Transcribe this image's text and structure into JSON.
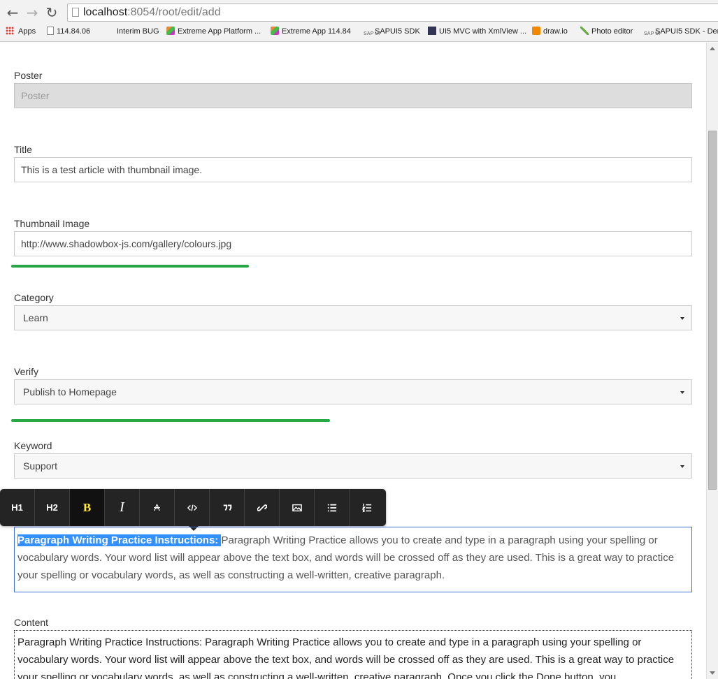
{
  "browser": {
    "url_host": "localhost",
    "url_path": ":8054/root/edit/add",
    "bookmarks": [
      {
        "label": "Apps",
        "icon": "apps-grid-icon"
      },
      {
        "label": "114.84.06",
        "icon": "page-icon"
      },
      {
        "label": "Interim BUG",
        "icon": ""
      },
      {
        "label": "Extreme App Platform ...",
        "icon": "puzzle-icon"
      },
      {
        "label": "Extreme App 114.84",
        "icon": "puzzle-icon"
      },
      {
        "label": "SAPUI5 SDK",
        "icon": "sap-icon"
      },
      {
        "label": "UI5 MVC with XmlView ...",
        "icon": "ui5-icon"
      },
      {
        "label": "draw.io",
        "icon": "drawio-icon"
      },
      {
        "label": "Photo editor",
        "icon": "photo-icon"
      },
      {
        "label": "SAPUI5 SDK - Dem",
        "icon": "sap-icon"
      }
    ]
  },
  "form": {
    "poster": {
      "label": "Poster",
      "placeholder": "Poster"
    },
    "title": {
      "label": "Title",
      "value": "This is a test article with thumbnail image."
    },
    "thumbnail": {
      "label": "Thumbnail Image",
      "value": "http://www.shadowbox-js.com/gallery/colours.jpg",
      "progress": 0.35
    },
    "category": {
      "label": "Category",
      "value": "Learn"
    },
    "verify": {
      "label": "Verify",
      "value": "Publish to Homepage",
      "progress": 0.47
    },
    "keyword": {
      "label": "Keyword",
      "value": "Support"
    },
    "content": {
      "label": "Content"
    }
  },
  "toolbar": {
    "h1": "H1",
    "h2": "H2",
    "bold": "B",
    "italic": "I",
    "strike": "A",
    "buttons": [
      "code-icon",
      "quote-icon",
      "link-icon",
      "image-icon",
      "unordered-list-icon",
      "ordered-list-icon"
    ]
  },
  "editor": {
    "selected_text": "Paragraph Writing Practice Instructions: ",
    "rest_text": "Paragraph Writing Practice allows you to create and type in a paragraph using your spelling or vocabulary words. Your word list will appear above the text box, and words will be crossed off as they are used. This is a great way to practice your spelling or vocabulary words, as well as constructing a well-written, creative paragraph."
  },
  "content_text": "Paragraph Writing Practice Instructions: Paragraph Writing Practice allows you to create and type in a paragraph using your spelling or vocabulary words. Your word list will appear above the text box, and words will be crossed off as they are used. This is a great way to practice your spelling or vocabulary words, as well as constructing a well-written, creative paragraph. Once you click the Done button, you",
  "colors": {
    "progress": "#27a844",
    "selection": "#3390ff",
    "toolbar": "#242424",
    "bold_active": "#ffec2e"
  }
}
